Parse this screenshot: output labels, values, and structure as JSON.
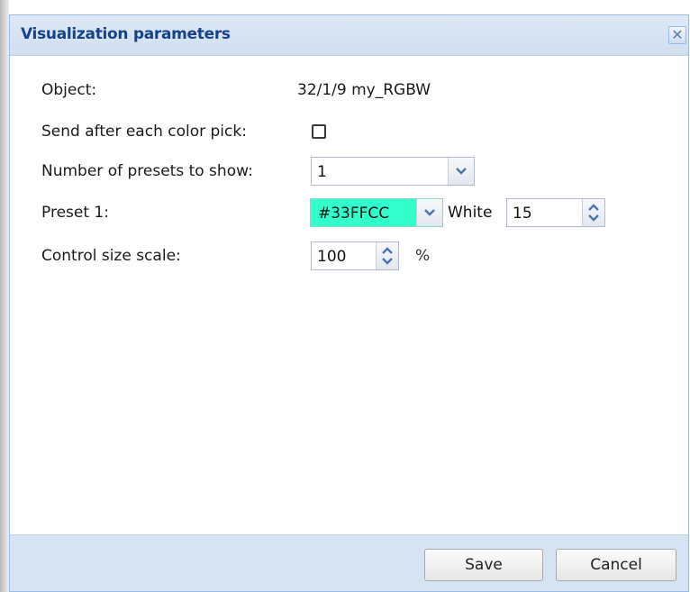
{
  "dialog": {
    "title": "Visualization parameters",
    "close_glyph": "✕"
  },
  "form": {
    "object": {
      "label": "Object:",
      "value": "32/1/9 my_RGBW"
    },
    "send_after_pick": {
      "label": "Send after each color pick:",
      "checked": false
    },
    "presets_count": {
      "label": "Number of presets to show:",
      "value": "1"
    },
    "preset1": {
      "label": "Preset 1:",
      "color_value": "#33FFCC",
      "color_swatch": "#33FFCC",
      "white_label": "White",
      "white_value": "15"
    },
    "scale": {
      "label": "Control size scale:",
      "value": "100",
      "unit": "%"
    }
  },
  "footer": {
    "save_label": "Save",
    "cancel_label": "Cancel"
  },
  "colors": {
    "title_text": "#15428b",
    "header_bg": "#d0def0",
    "footer_bg": "#d6e3f3",
    "icon_blue": "#4b74b0"
  },
  "icons": {
    "close": "close-icon",
    "combo": "chevron-down-icon",
    "spinner_up": "chevron-up-icon",
    "spinner_down": "chevron-down-icon"
  }
}
